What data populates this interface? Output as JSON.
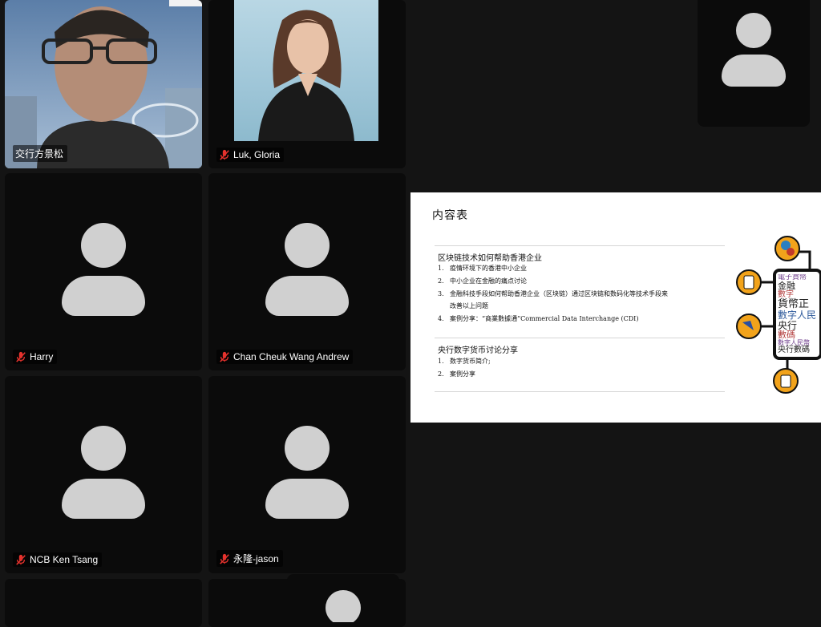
{
  "participants": [
    {
      "name": "交行方景松",
      "muted": false,
      "video": true
    },
    {
      "name": "Luk, Gloria",
      "muted": true,
      "video": true
    },
    {
      "name": "Harry",
      "muted": true,
      "video": false
    },
    {
      "name": "Chan Cheuk Wang Andrew",
      "muted": true,
      "video": false
    },
    {
      "name": "NCB Ken Tsang",
      "muted": true,
      "video": false
    },
    {
      "name": "永隆-jason",
      "muted": true,
      "video": false
    }
  ],
  "slide": {
    "title": "内容表",
    "section1": {
      "heading": "区块链技术如何帮助香港企业",
      "items": [
        {
          "num": "1.",
          "text": "疫情环境下的香港中小企业"
        },
        {
          "num": "2.",
          "text": "中小企业在金融的痛点讨论"
        },
        {
          "num": "3.",
          "text": "金融科技手段如何帮助香港企业（区块链）通过区块链和数码化等技术手段来"
        },
        {
          "num": "",
          "text": "改善以上问题"
        },
        {
          "num": "4.",
          "text": "案例分享：“商業數據通”Commercial Data Interchange (CDI)"
        }
      ]
    },
    "section2": {
      "heading": "央行数字货币讨论分享",
      "items": [
        {
          "num": "1.",
          "text": "数字货币简介;"
        },
        {
          "num": "2.",
          "text": "案例分享"
        }
      ]
    },
    "collage_words": [
      "電子貨幣",
      "金融",
      "數字",
      "貨幣正",
      "數字人民",
      "央行",
      "數碼",
      "數字人民幣",
      "央行數碼"
    ]
  },
  "icons": {
    "muted_mic": "muted-mic-icon",
    "avatar": "default-avatar-icon"
  },
  "colors": {
    "muted_red": "#e5322d",
    "tile_bg": "#0b0b0b",
    "avatar_gray": "#d0d0d0",
    "orange": "#f2a31b"
  }
}
